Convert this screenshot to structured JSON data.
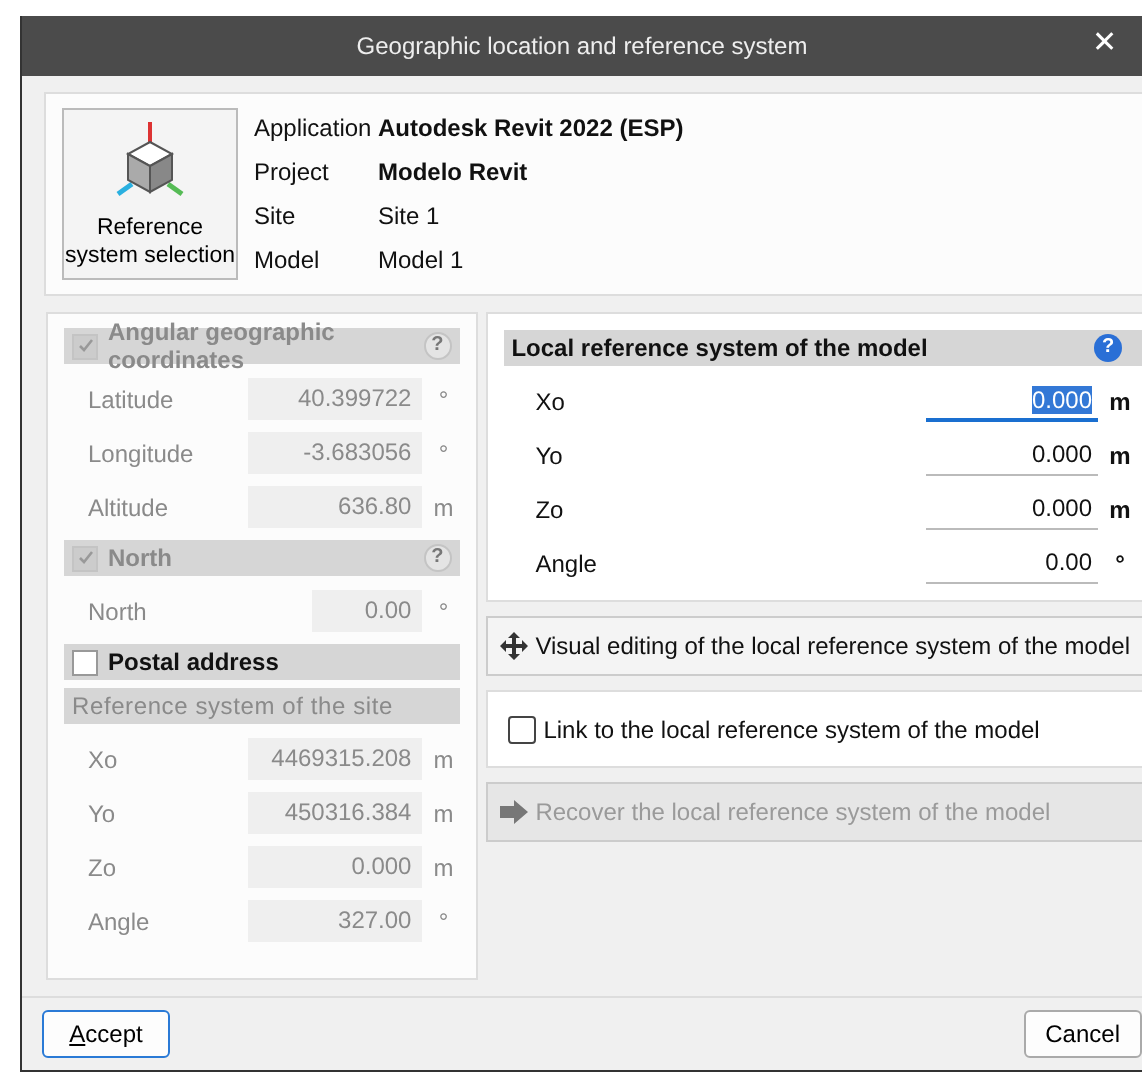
{
  "window": {
    "title": "Geographic location and reference system",
    "close": "✕"
  },
  "info": {
    "reference_button": "Reference system selection",
    "rows": [
      {
        "label": "Application",
        "value": "Autodesk Revit 2022 (ESP)",
        "bold": true
      },
      {
        "label": "Project",
        "value": "Modelo Revit",
        "bold": true
      },
      {
        "label": "Site",
        "value": "Site 1",
        "bold": false
      },
      {
        "label": "Model",
        "value": "Model 1",
        "bold": false
      }
    ]
  },
  "left": [
    {
      "kind": "checkable",
      "title": "Angular geographic coordinates",
      "checked": true,
      "disabled": true,
      "help": "?",
      "fields": [
        {
          "label": "Latitude",
          "value": "40.399722",
          "unit": "°",
          "wide": true
        },
        {
          "label": "Longitude",
          "value": "-3.683056",
          "unit": "°",
          "wide": true
        },
        {
          "label": "Altitude",
          "value": "636.80",
          "unit": "m",
          "wide": true
        }
      ]
    },
    {
      "kind": "checkable",
      "title": "North",
      "checked": true,
      "disabled": true,
      "help": "?",
      "fields": [
        {
          "label": "North",
          "value": "0.00",
          "unit": "°",
          "wide": false
        }
      ]
    },
    {
      "kind": "checkable",
      "title": "Postal address",
      "checked": false,
      "disabled": false
    },
    {
      "kind": "plain",
      "title": "Reference system of the site",
      "disabled": true,
      "fields": [
        {
          "label": "Xo",
          "value": "4469315.208",
          "unit": "m",
          "wide": true
        },
        {
          "label": "Yo",
          "value": "450316.384",
          "unit": "m",
          "wide": true
        },
        {
          "label": "Zo",
          "value": "0.000",
          "unit": "m",
          "wide": true
        },
        {
          "label": "Angle",
          "value": "327.00",
          "unit": "°",
          "wide": true
        }
      ]
    }
  ],
  "local": {
    "title": "Local reference system of the model",
    "help": "?",
    "fields": [
      {
        "label": "Xo",
        "value": "0.000",
        "unit": "m",
        "focused": true
      },
      {
        "label": "Yo",
        "value": "0.000",
        "unit": "m",
        "focused": false
      },
      {
        "label": "Zo",
        "value": "0.000",
        "unit": "m",
        "focused": false
      },
      {
        "label": "Angle",
        "value": "0.00",
        "unit": "°",
        "focused": false
      }
    ]
  },
  "visual_button": {
    "label": "Visual editing of the local reference system of the model"
  },
  "link": {
    "label": "Link to the local reference system of the model",
    "checked": false
  },
  "recover_button": {
    "label": "Recover the local reference system of the model",
    "disabled": true
  },
  "buttons": [
    {
      "label": "Accept",
      "kind": "default"
    },
    {
      "label": "Cancel",
      "kind": "normal"
    }
  ]
}
